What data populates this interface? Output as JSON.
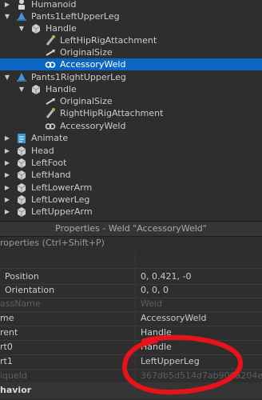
{
  "explorer": {
    "humanoid": "Humanoid",
    "pants_left": "Pants1LeftUpperLeg",
    "handle_left": "Handle",
    "left_hip_att": "LeftHipRigAttachment",
    "orig_size_left": "OriginalSize",
    "acc_weld_left": "AccessoryWeld",
    "pants_right": "Pants1RightUpperLeg",
    "handle_right": "Handle",
    "orig_size_right": "OriginalSize",
    "right_hip_att": "RightHipRigAttachment",
    "acc_weld_right": "AccessoryWeld",
    "animate": "Animate",
    "head": "Head",
    "left_foot": "LeftFoot",
    "left_hand": "LeftHand",
    "left_lower_arm": "LeftLowerArm",
    "left_lower_leg": "LeftLowerLeg",
    "left_upper_arm": "LeftUpperArm"
  },
  "properties": {
    "title": "Properties - Weld \"AccessoryWeld\"",
    "filter_placeholder": "roperties (Ctrl+Shift+P)",
    "rows": {
      "position_name": "Position",
      "position_value": "0, 0.421, -0",
      "orientation_name": "Orientation",
      "orientation_value": "0, 0, 0",
      "classname_name": "assName",
      "classname_value": "Weld",
      "name_name": "me",
      "name_value": "AccessoryWeld",
      "parent_name": "rent",
      "parent_value": "Handle",
      "part0_name": "rt0",
      "part0_value": "Handle",
      "part1_name": "rt1",
      "part1_value": "LeftUpperLeg",
      "uniqueid_name": "iqueId",
      "uniqueid_value": "367db5d514d7ab906a204ed00000"
    },
    "section_behavior": "havior"
  },
  "colors": {
    "selection": "#0a66c2",
    "annotation": "#e8131a"
  }
}
